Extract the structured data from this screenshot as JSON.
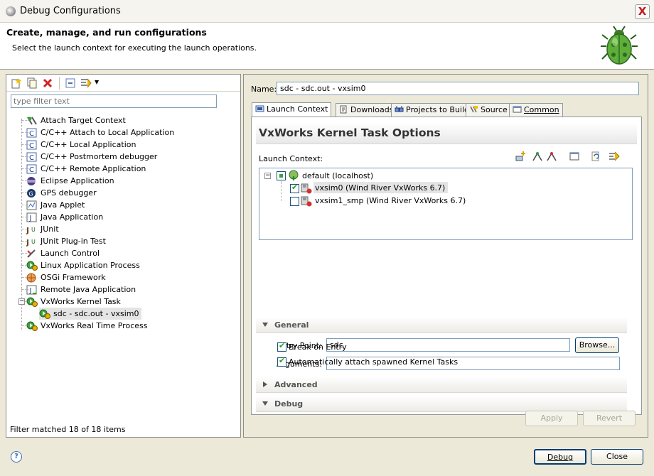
{
  "window": {
    "title": "Debug Configurations",
    "close_label": "X"
  },
  "header": {
    "title": "Create, manage, and run configurations",
    "subtitle": "Select the launch context for executing the launch operations."
  },
  "left": {
    "filter_placeholder": "type filter text",
    "tree": [
      {
        "label": "Attach Target Context",
        "icon": "attach-target-icon"
      },
      {
        "label": "C/C++ Attach to Local Application",
        "icon": "c-app-icon"
      },
      {
        "label": "C/C++ Local Application",
        "icon": "c-app-icon"
      },
      {
        "label": "C/C++ Postmortem debugger",
        "icon": "c-app-icon"
      },
      {
        "label": "C/C++ Remote Application",
        "icon": "c-app-icon"
      },
      {
        "label": "Eclipse Application",
        "icon": "eclipse-icon"
      },
      {
        "label": "GPS debugger",
        "icon": "gps-icon"
      },
      {
        "label": "Java Applet",
        "icon": "java-applet-icon"
      },
      {
        "label": "Java Application",
        "icon": "java-app-icon"
      },
      {
        "label": "JUnit",
        "icon": "junit-icon"
      },
      {
        "label": "JUnit Plug-in Test",
        "icon": "junit-icon"
      },
      {
        "label": "Launch Control",
        "icon": "launch-control-icon"
      },
      {
        "label": "Linux Application Process",
        "icon": "process-icon"
      },
      {
        "label": "OSGi Framework",
        "icon": "osgi-icon"
      },
      {
        "label": "Remote Java Application",
        "icon": "remote-java-icon"
      },
      {
        "label": "VxWorks Kernel Task",
        "icon": "process-icon"
      },
      {
        "label": "sdc - sdc.out - vxsim0",
        "icon": "process-icon"
      },
      {
        "label": "VxWorks Real Time Process",
        "icon": "process-icon"
      }
    ],
    "status": "Filter matched 18 of 18 items"
  },
  "right": {
    "name_label": "Name:",
    "name_value": "sdc - sdc.out - vxsim0",
    "tabs": [
      "Launch Context",
      "Downloads",
      "Projects to Build",
      "Source",
      "Common"
    ],
    "options_title": "VxWorks Kernel Task Options",
    "launch_context_label": "Launch Context:",
    "context_tree": {
      "root": "default (localhost)",
      "children": [
        "vxsim0 (Wind River VxWorks 6.7)",
        "vxsim1_smp (Wind River VxWorks 6.7)"
      ]
    },
    "general": {
      "title": "General",
      "entry_point_label": "Entry Point:",
      "entry_point_value": "sdc",
      "browse_label": "Browse...",
      "arguments_label": "Arguments:",
      "arguments_value": ""
    },
    "advanced_title": "Advanced",
    "debug": {
      "title": "Debug",
      "break_on_entry": "Break on Entry",
      "auto_attach": "Automatically attach spawned Kernel Tasks"
    },
    "apply_label": "Apply",
    "revert_label": "Revert"
  },
  "footer": {
    "help_label": "?",
    "debug_label": "Debug",
    "close_label": "Close"
  }
}
